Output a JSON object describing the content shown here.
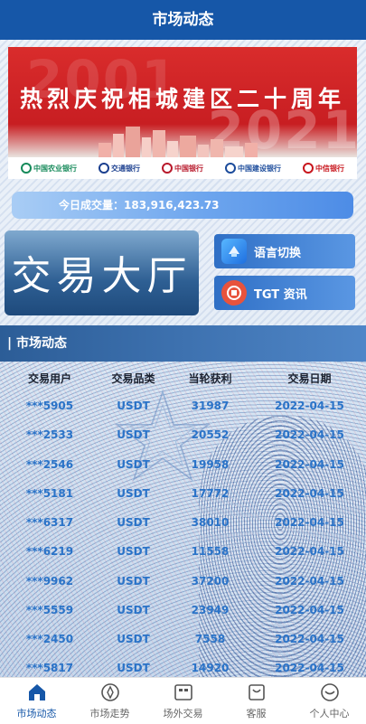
{
  "header": {
    "title": "市场动态"
  },
  "banner": {
    "title": "热烈庆祝相城建区二十周年",
    "year_left": "2001",
    "year_right": "2021",
    "banks": [
      {
        "name": "中国农业银行",
        "color": "#168a5a"
      },
      {
        "name": "交通银行",
        "color": "#1b3f8f"
      },
      {
        "name": "中国银行",
        "color": "#b8192b"
      },
      {
        "name": "中国建设银行",
        "color": "#1b4b9b"
      },
      {
        "name": "中信银行",
        "color": "#c8161d"
      }
    ]
  },
  "volume": {
    "text": "今日成交量：183,916,423.73"
  },
  "hall": {
    "text": "交易大厅"
  },
  "buttons": {
    "language": "语言切换",
    "tgt": "TGT 资讯"
  },
  "section": {
    "title": "| 市场动态"
  },
  "table": {
    "headers": [
      "交易用户",
      "交易品类",
      "当轮获利",
      "交易日期"
    ],
    "rows": [
      [
        "***5905",
        "USDT",
        "31987",
        "2022-04-15"
      ],
      [
        "***2533",
        "USDT",
        "20552",
        "2022-04-15"
      ],
      [
        "***2546",
        "USDT",
        "19958",
        "2022-04-15"
      ],
      [
        "***5181",
        "USDT",
        "17772",
        "2022-04-15"
      ],
      [
        "***6317",
        "USDT",
        "38010",
        "2022-04-15"
      ],
      [
        "***6219",
        "USDT",
        "11558",
        "2022-04-15"
      ],
      [
        "***9962",
        "USDT",
        "37200",
        "2022-04-15"
      ],
      [
        "***5559",
        "USDT",
        "23949",
        "2022-04-15"
      ],
      [
        "***2450",
        "USDT",
        "7558",
        "2022-04-15"
      ],
      [
        "***5817",
        "USDT",
        "14920",
        "2022-04-15"
      ]
    ]
  },
  "tabbar": {
    "items": [
      {
        "label": "市场动态",
        "icon": "home-icon",
        "active": true
      },
      {
        "label": "市场走势",
        "icon": "compass-icon",
        "active": false
      },
      {
        "label": "场外交易",
        "icon": "exchange-icon",
        "active": false
      },
      {
        "label": "客服",
        "icon": "service-icon",
        "active": false
      },
      {
        "label": "个人中心",
        "icon": "user-icon",
        "active": false
      }
    ]
  },
  "colors": {
    "primary": "#1657a8",
    "accent_text": "#2a73c8",
    "banner_red": "#c81e22"
  }
}
